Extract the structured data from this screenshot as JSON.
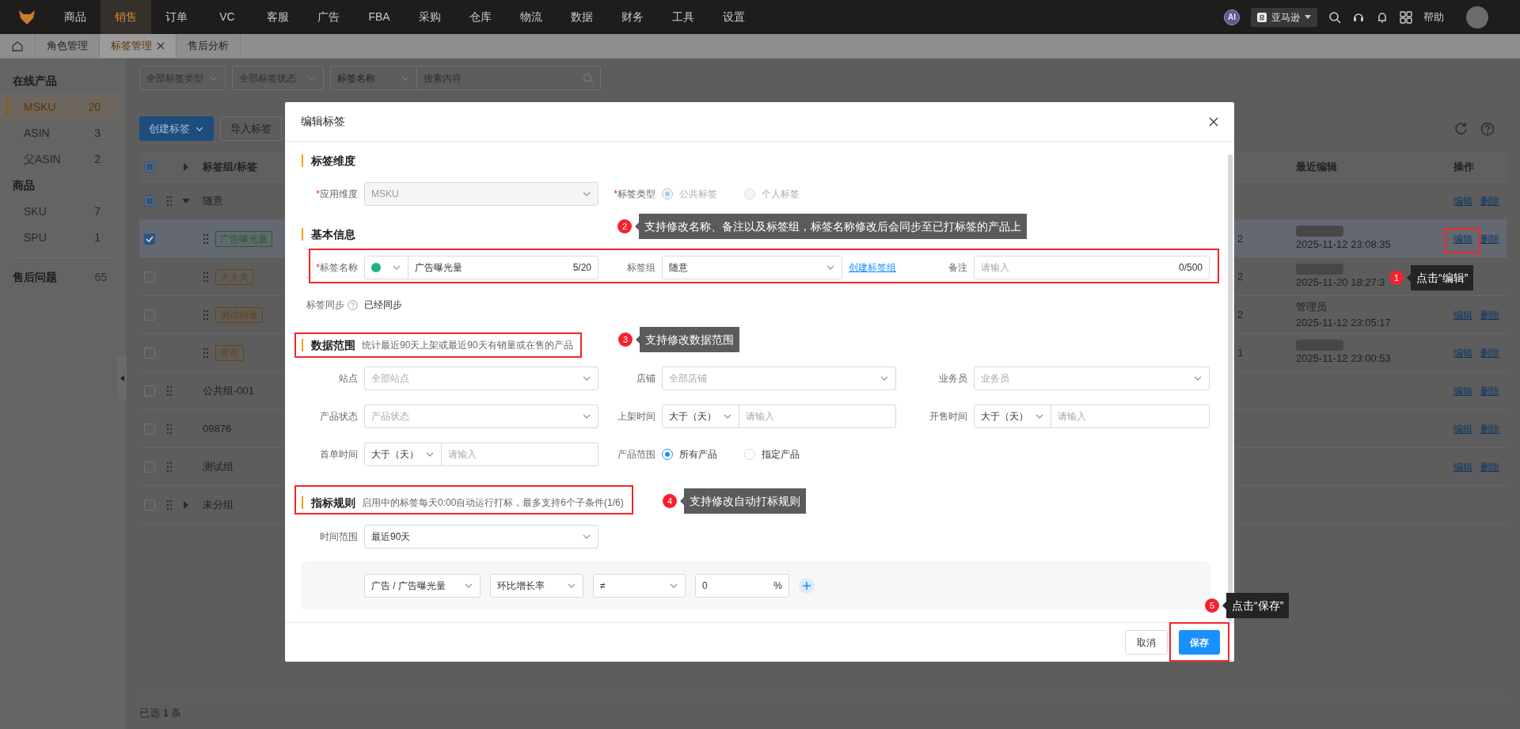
{
  "nav": {
    "items": [
      {
        "label": "商品",
        "selected": false
      },
      {
        "label": "销售",
        "selected": true
      },
      {
        "label": "订单",
        "selected": false
      },
      {
        "label": "VC",
        "selected": false
      },
      {
        "label": "客服",
        "selected": false
      },
      {
        "label": "广告",
        "selected": false
      },
      {
        "label": "FBA",
        "selected": false
      },
      {
        "label": "采购",
        "selected": false
      },
      {
        "label": "仓库",
        "selected": false
      },
      {
        "label": "物流",
        "selected": false
      },
      {
        "label": "数据",
        "selected": false
      },
      {
        "label": "财务",
        "selected": false
      },
      {
        "label": "工具",
        "selected": false
      },
      {
        "label": "设置",
        "selected": false
      }
    ],
    "ai_badge": "AI",
    "marketplace": "亚马逊",
    "help": "帮助"
  },
  "tabs": [
    {
      "label": "角色管理",
      "selected": false,
      "closable": false
    },
    {
      "label": "标签管理",
      "selected": true,
      "closable": true
    },
    {
      "label": "售后分析",
      "selected": false,
      "closable": false
    }
  ],
  "sidebar": {
    "groups": [
      {
        "title": "在线产品",
        "items": [
          {
            "label": "MSKU",
            "count": "20",
            "selected": true
          },
          {
            "label": "ASIN",
            "count": "3",
            "selected": false
          },
          {
            "label": "父ASIN",
            "count": "2",
            "selected": false
          }
        ]
      },
      {
        "title": "商品",
        "items": [
          {
            "label": "SKU",
            "count": "7",
            "selected": false
          },
          {
            "label": "SPU",
            "count": "1",
            "selected": false
          }
        ]
      }
    ],
    "after_sales": {
      "label": "售后问题",
      "count": "65"
    }
  },
  "filters": {
    "type_placeholder": "全部标签类型",
    "status_placeholder": "全部标签状态",
    "search_field": "标签名称",
    "search_placeholder": "搜索内容"
  },
  "toolbar": {
    "create": "创建标签",
    "import": "导入标签"
  },
  "table": {
    "columns": [
      "标签组/标签",
      "最近编辑",
      "操作"
    ],
    "header_checked": false,
    "header_indeterminate": true,
    "rows": [
      {
        "kind": "group",
        "name": "随意",
        "expanded": true,
        "checked": false,
        "indeterminate": true,
        "selected": false,
        "actions": [
          "编辑",
          "删除"
        ]
      },
      {
        "kind": "tag",
        "name": "广告曝光量",
        "color": "#1d5e2e",
        "checked": true,
        "indeterminate": false,
        "selected": true,
        "column_3": "2",
        "editor_blurred": true,
        "edited": "2025-11-12 23:08:35",
        "actions": [
          "编辑",
          "删除"
        ]
      },
      {
        "kind": "tag",
        "name": "大大大",
        "color": "#6b4508",
        "checked": false,
        "indeterminate": false,
        "selected": false,
        "column_3": "2",
        "editor_blurred": true,
        "edited": "2025-11-20 18:27:3"
      },
      {
        "kind": "tag",
        "name": "测试销量",
        "color": "#6b4508",
        "checked": false,
        "indeterminate": false,
        "selected": false,
        "column_3": "2",
        "editor_blurred": false,
        "editor": "管理员",
        "edited": "2025-11-12 23:05:17",
        "actions": [
          "编辑",
          "删除"
        ]
      },
      {
        "kind": "tag",
        "name": "黄色",
        "color": "#6b4508",
        "checked": false,
        "indeterminate": false,
        "selected": false,
        "column_3": "1",
        "editor_blurred": true,
        "edited": "2025-11-12 23:00:53",
        "actions": [
          "编辑",
          "删除"
        ]
      },
      {
        "kind": "group",
        "name": "公共组-001",
        "checked": false,
        "indeterminate": false,
        "selected": false,
        "actions": [
          "编辑",
          "删除"
        ]
      },
      {
        "kind": "group",
        "name": "09876",
        "checked": false,
        "indeterminate": false,
        "selected": false,
        "actions": [
          "编辑",
          "删除"
        ]
      },
      {
        "kind": "group",
        "name": "测试组",
        "checked": false,
        "indeterminate": false,
        "selected": false,
        "actions": [
          "编辑",
          "删除"
        ]
      },
      {
        "kind": "group",
        "name": "未分组",
        "expanded": false,
        "checked": false,
        "indeterminate": false,
        "selected": false
      }
    ]
  },
  "selection": "已选 **1** 条",
  "dialog": {
    "title": "编辑标签",
    "dimension": {
      "title": "标签维度",
      "apply_label": {
        "mark": "*",
        "text": "应用维度"
      },
      "apply_value": "MSKU",
      "apply_disabled": true,
      "type_label": {
        "mark": "*",
        "text": "标签类型"
      },
      "type_options": [
        {
          "label": "公共标签",
          "selected": true,
          "disabled": true
        },
        {
          "label": "个人标签",
          "selected": false,
          "disabled": true
        }
      ]
    },
    "basic": {
      "title": "基本信息",
      "name_label": {
        "mark": "*",
        "text": "标签名称"
      },
      "color": "#1fb27e",
      "name_value": "广告曝光量",
      "name_count": "5/20",
      "group_label": "标签组",
      "group_value": "随意",
      "create_group": "创建标签组",
      "note_label": "备注",
      "note_placeholder": "请输入",
      "note_count": "0/500",
      "sync_label": "标签同步",
      "sync_value": "已经同步"
    },
    "scope": {
      "title": "数据范围",
      "description": "统计最近90天上架或最近90天有销量或在售的产品",
      "site_label": "站点",
      "site_placeholder": "全部站点",
      "shop_label": "店铺",
      "shop_placeholder": "全部店铺",
      "staff_label": "业务员",
      "staff_placeholder": "业务员",
      "status_label": "产品状态",
      "status_placeholder": "产品状态",
      "listed_label": "上架时间",
      "listed_op": "大于（天）",
      "listed_placeholder": "请输入",
      "sale_label": "开售时间",
      "sale_op": "大于（天）",
      "sale_placeholder": "请输入",
      "first_label": "首单时间",
      "first_op": "大于（天）",
      "first_placeholder": "请输入",
      "range_label": "产品范围",
      "range_options": [
        {
          "label": "所有产品",
          "selected": true
        },
        {
          "label": "指定产品",
          "selected": false
        }
      ]
    },
    "rules": {
      "title": "指标规则",
      "description": "启用中的标签每天0:00自动运行打标，最多支持6个子条件(1/6)",
      "time_label": "时间范围",
      "time_value": "最近90天",
      "conditions": [
        {
          "metric": "广告 / 广告曝光量",
          "calc": "环比增长率",
          "operator": "≠",
          "value": "0",
          "unit": "%"
        }
      ]
    },
    "cancel": "取消",
    "save": "保存"
  },
  "callouts": [
    {
      "number": "2",
      "text": "支持修改名称、备注以及标签组，标签名称修改后会同步至已打标签的产品上",
      "kind": "gray"
    },
    {
      "number": "1",
      "text": "点击“编辑”",
      "kind": "dark"
    },
    {
      "number": "3",
      "text": "支持修改数据范围",
      "kind": "gray"
    },
    {
      "number": "4",
      "text": "支持修改自动打标规则",
      "kind": "gray"
    },
    {
      "number": "5",
      "text": "点击“保存”",
      "kind": "dark"
    }
  ]
}
